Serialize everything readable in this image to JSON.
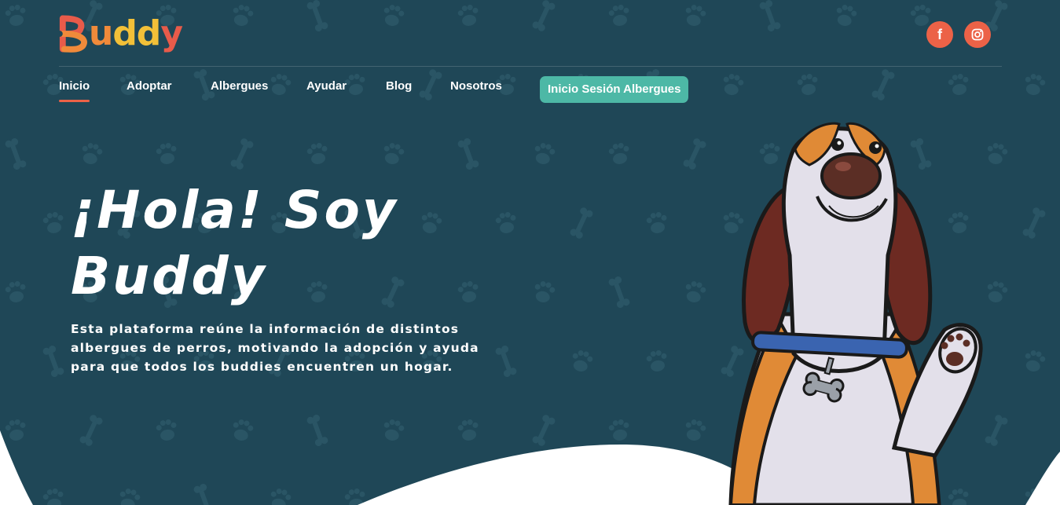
{
  "logo": {
    "text_parts": [
      "B",
      "u",
      "dd",
      "y"
    ]
  },
  "colors": {
    "background": "#1f4757",
    "accent_orange": "#ec6247",
    "accent_teal": "#4db8a6",
    "text": "#ffffff"
  },
  "social": [
    {
      "name": "facebook-icon",
      "glyph": "f"
    },
    {
      "name": "instagram-icon"
    }
  ],
  "nav": {
    "items": [
      {
        "label": "Inicio",
        "active": true
      },
      {
        "label": "Adoptar"
      },
      {
        "label": "Albergues"
      },
      {
        "label": "Ayudar"
      },
      {
        "label": "Blog"
      },
      {
        "label": "Nosotros"
      }
    ],
    "login_label": "Inicio Sesión Albergues"
  },
  "hero": {
    "title_line1": "¡Hola! Soy",
    "title_line2": "Buddy",
    "description_line1": "Esta plataforma reúne la información de distintos",
    "description_line2": "albergues de perros, motivando la adopción y ayuda",
    "description_line3": "para que todos los buddies encuentren un hogar."
  }
}
